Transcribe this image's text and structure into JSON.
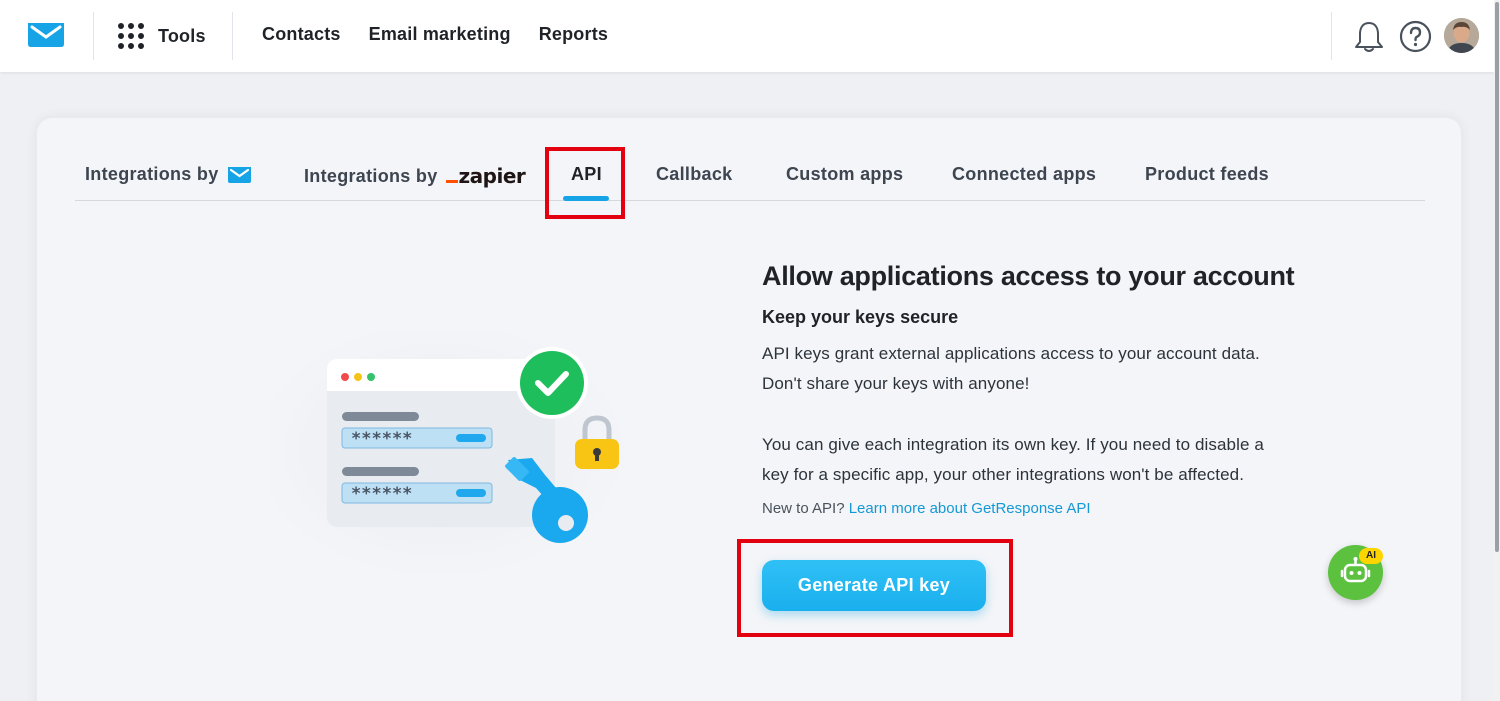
{
  "nav": {
    "tools_label": "Tools",
    "links": [
      "Contacts",
      "Email marketing",
      "Reports"
    ],
    "icons": {
      "notifications": "bell-icon",
      "help": "question-circle-icon",
      "profile": "avatar"
    }
  },
  "tabs": {
    "integrations_by": "Integrations by",
    "zapier_brand": "zapier",
    "api": "API",
    "callback": "Callback",
    "custom_apps": "Custom apps",
    "connected_apps": "Connected apps",
    "product_feeds": "Product feeds",
    "active": "API"
  },
  "illustration": {
    "masked_value_1": "******",
    "masked_value_2": "******"
  },
  "content": {
    "heading": "Allow applications access to your account",
    "subheading": "Keep your keys secure",
    "para1_line1": "API keys grant external applications access to your account data.",
    "para1_line2": "Don't share your keys with anyone!",
    "para2_line1": "You can give each integration its own key. If you need to disable a",
    "para2_line2": "key for a specific app, your other integrations won't be affected.",
    "new_to_api": "New to API?",
    "learn_more": "Learn more about GetResponse API",
    "generate_button": "Generate API key"
  },
  "ai_assistant": {
    "badge": "AI"
  },
  "colors": {
    "brand_blue": "#16a4e6",
    "button": "#1ab0ee",
    "highlight": "#e3000f",
    "ai_green": "#5cc13e",
    "zapier_orange": "#ff4f00"
  }
}
